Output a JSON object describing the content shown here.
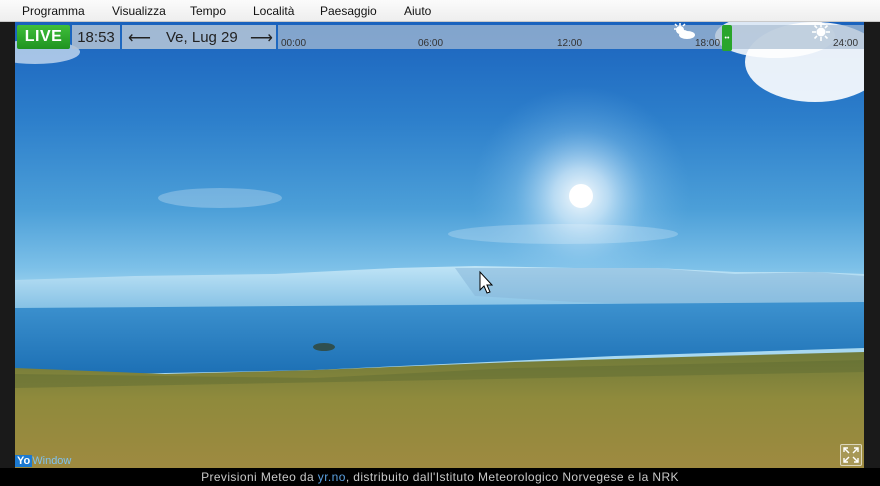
{
  "menu": {
    "items": [
      "Programma",
      "Visualizza",
      "Tempo",
      "Località",
      "Paesaggio",
      "Aiuto"
    ]
  },
  "controls": {
    "live_label": "LIVE",
    "time": "18:53",
    "date": "Ve, Lug 29",
    "prev_arrow": "⟵",
    "next_arrow": "⟶",
    "timeline_ticks": [
      "00:00",
      "06:00",
      "12:00",
      "18:00",
      "24:00"
    ],
    "marker_glyph": "••"
  },
  "icons": {
    "partly_cloudy": "partly-cloudy-icon",
    "sun": "sun-icon",
    "fullscreen": "fullscreen-icon",
    "cursor": "mouse-cursor-icon"
  },
  "branding": {
    "logo_yo": "Yo",
    "logo_window": "Window"
  },
  "status": {
    "prefix": "Previsioni Meteo da",
    "link": "yr.no",
    "suffix": ", distribuito dall'Istituto Meteorologico Norvegese e la NRK"
  },
  "colors": {
    "live_green": "#29a52b",
    "sky_top": "#1a62bd",
    "water": "#2a7fc0",
    "grass": "#8d8a3a"
  }
}
